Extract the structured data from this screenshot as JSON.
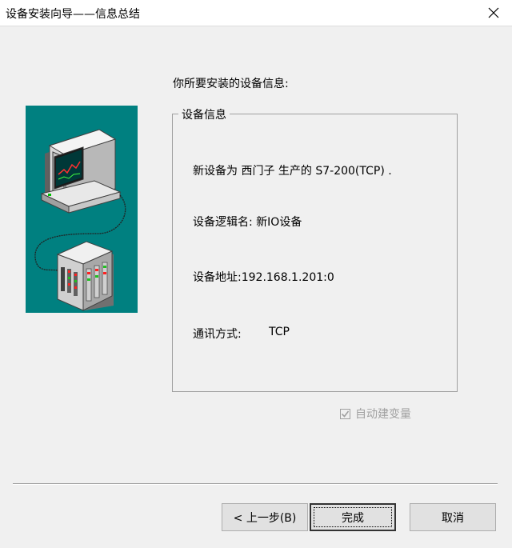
{
  "window": {
    "title": "设备安装向导——信息总结",
    "close_icon": "close-icon"
  },
  "heading": "你所要安装的设备信息:",
  "group": {
    "legend": "设备信息",
    "new_device": "新设备为 西门子 生产的 S7-200(TCP) .",
    "logical_name": "设备逻辑名: 新IO设备",
    "address": "设备地址:192.168.1.201:0",
    "comm_label": "通讯方式:",
    "comm_value": "TCP"
  },
  "auto_create_var": {
    "label": "自动建变量",
    "checked": true,
    "enabled": false
  },
  "buttons": {
    "back": "< 上一步(B)",
    "finish": "完成",
    "cancel": "取消"
  },
  "colors": {
    "illustration_bg": "#008080",
    "window_bg": "#f0f0f0"
  },
  "illustration": {
    "icons": [
      "computer-monitor-icon",
      "plc-device-icon"
    ]
  }
}
